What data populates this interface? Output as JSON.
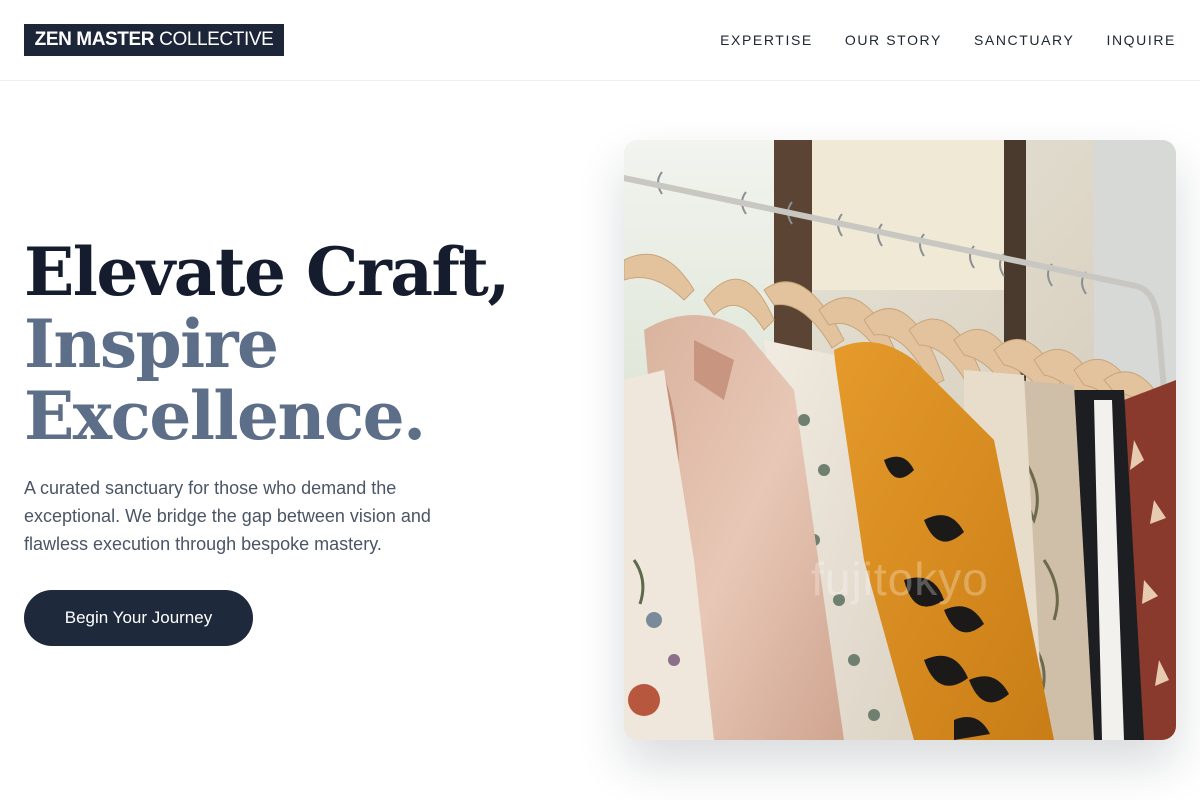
{
  "header": {
    "logo_strong": "ZEN MASTER",
    "logo_light": "COLLECTIVE",
    "nav": [
      "EXPERTISE",
      "OUR STORY",
      "SANCTUARY",
      "INQUIRE"
    ]
  },
  "hero": {
    "title_line1": "Elevate Craft,",
    "title_line2": "Inspire",
    "title_line3": "Excellence.",
    "description": "A curated sanctuary for those who demand the exceptional. We bridge the gap between vision and flawless execution through bespoke mastery.",
    "cta_label": "Begin Your Journey",
    "image_watermark": "fujitokyo"
  },
  "colors": {
    "brand_navy": "#1c2638",
    "accent_slate": "#5d6e89",
    "button": "#1e293b"
  }
}
